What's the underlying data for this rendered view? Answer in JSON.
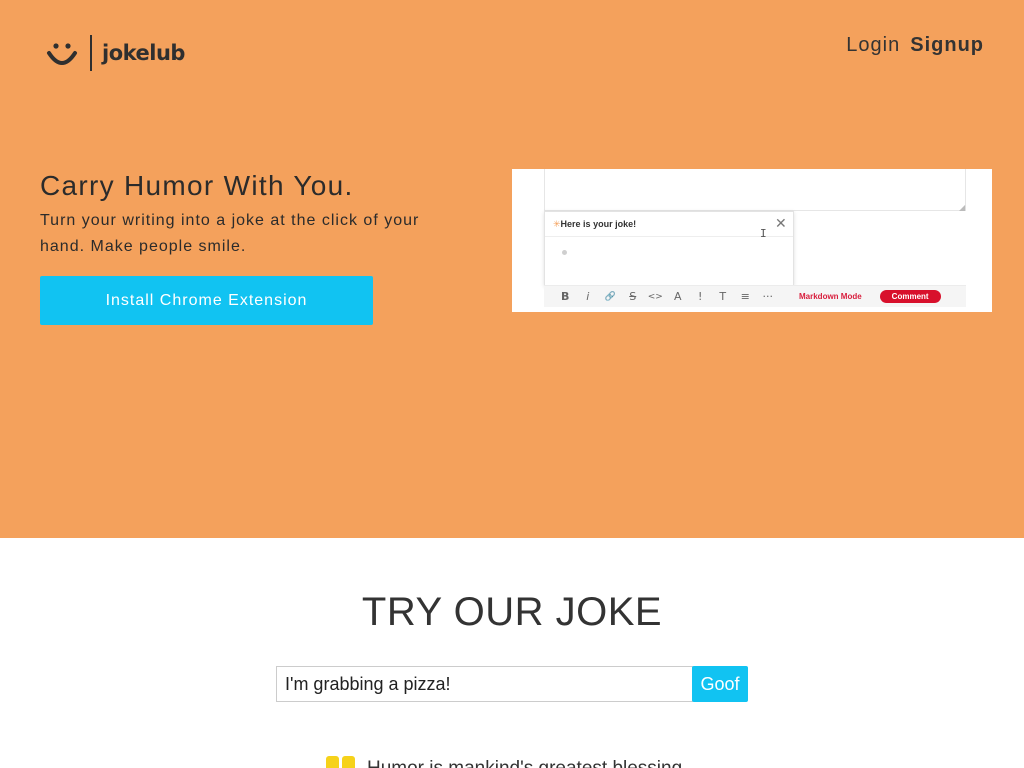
{
  "brand": {
    "name": "jokelub",
    "icon": "smiley-icon"
  },
  "nav": {
    "login": "Login",
    "signup": "Signup"
  },
  "hero": {
    "title": "Carry Humor With You.",
    "subtitle": "Turn your writing into a joke at the click of your hand. Make people smile.",
    "install_button": "Install Chrome Extension",
    "background_color": "#f4a15c"
  },
  "preview": {
    "popup_title": "Here is your joke!",
    "toolbar_icons": [
      "B",
      "i",
      "🔗",
      "S",
      "<>",
      "A",
      "!",
      "T",
      "≡",
      "···"
    ],
    "markdown_mode": "Markdown Mode",
    "comment_button": "Comment"
  },
  "try_section": {
    "title": "TRY OUR JOKE",
    "input_value": "I'm grabbing a pizza!",
    "goof_button": "Goof",
    "quote": "Humor is mankind's greatest blessing."
  },
  "colors": {
    "accent": "#11c3f2",
    "quote_mark": "#f6d21a",
    "text": "#333333"
  }
}
